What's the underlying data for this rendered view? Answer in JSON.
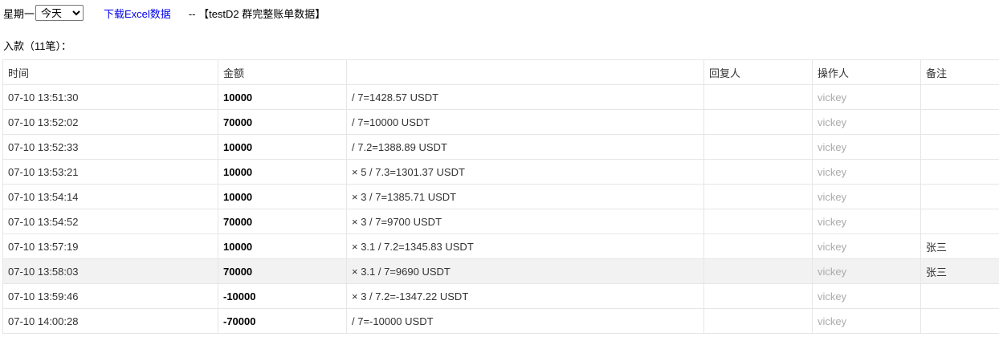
{
  "toolbar": {
    "weekday_label": "星期一",
    "period_selected": "今天",
    "download_label": "下载Excel数据",
    "group_title": "-- 【testD2 群完整账单数据】"
  },
  "section": {
    "title": "入款（11笔）："
  },
  "table": {
    "headers": [
      "时间",
      "金额",
      "",
      "回复人",
      "操作人",
      "备注"
    ],
    "rows": [
      {
        "time": "07-10 13:51:30",
        "amount": "10000",
        "formula": "/ 7=1428.57 USDT",
        "replier": "",
        "operator": "vickey",
        "note": ""
      },
      {
        "time": "07-10 13:52:02",
        "amount": "70000",
        "formula": "/ 7=10000 USDT",
        "replier": "",
        "operator": "vickey",
        "note": ""
      },
      {
        "time": "07-10 13:52:33",
        "amount": "10000",
        "formula": "/ 7.2=1388.89 USDT",
        "replier": "",
        "operator": "vickey",
        "note": ""
      },
      {
        "time": "07-10 13:53:21",
        "amount": "10000",
        "formula": "× 5 / 7.3=1301.37 USDT",
        "replier": "",
        "operator": "vickey",
        "note": ""
      },
      {
        "time": "07-10 13:54:14",
        "amount": "10000",
        "formula": "× 3 / 7=1385.71 USDT",
        "replier": "",
        "operator": "vickey",
        "note": ""
      },
      {
        "time": "07-10 13:54:52",
        "amount": "70000",
        "formula": "× 3 / 7=9700 USDT",
        "replier": "",
        "operator": "vickey",
        "note": ""
      },
      {
        "time": "07-10 13:57:19",
        "amount": "10000",
        "formula": "× 3.1 / 7.2=1345.83 USDT",
        "replier": "",
        "operator": "vickey",
        "note": "张三"
      },
      {
        "time": "07-10 13:58:03",
        "amount": "70000",
        "formula": "× 3.1 / 7=9690 USDT",
        "replier": "",
        "operator": "vickey",
        "note": "张三"
      },
      {
        "time": "07-10 13:59:46",
        "amount": "-10000",
        "formula": "× 3 / 7.2=-1347.22 USDT",
        "replier": "",
        "operator": "vickey",
        "note": ""
      },
      {
        "time": "07-10 14:00:28",
        "amount": "-70000",
        "formula": "/ 7=-10000 USDT",
        "replier": "",
        "operator": "vickey",
        "note": ""
      }
    ]
  }
}
